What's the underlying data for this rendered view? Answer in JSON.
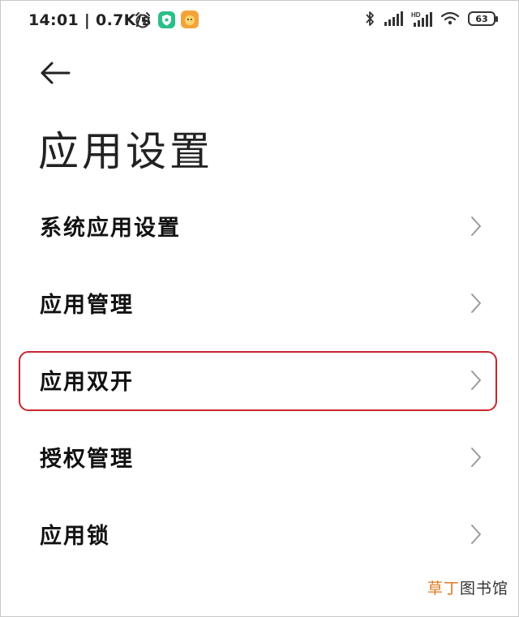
{
  "status_bar": {
    "time_speed": "14:01 | 0.7K/s",
    "battery": "63",
    "hd_label": "HD"
  },
  "page": {
    "title": "应用设置"
  },
  "menu": {
    "items": [
      {
        "label": "系统应用设置"
      },
      {
        "label": "应用管理"
      },
      {
        "label": "应用双开"
      },
      {
        "label": "授权管理"
      },
      {
        "label": "应用锁"
      }
    ]
  },
  "highlight_color": "#c8262f",
  "watermark": {
    "accent": "草丁",
    "rest": "图书馆"
  }
}
